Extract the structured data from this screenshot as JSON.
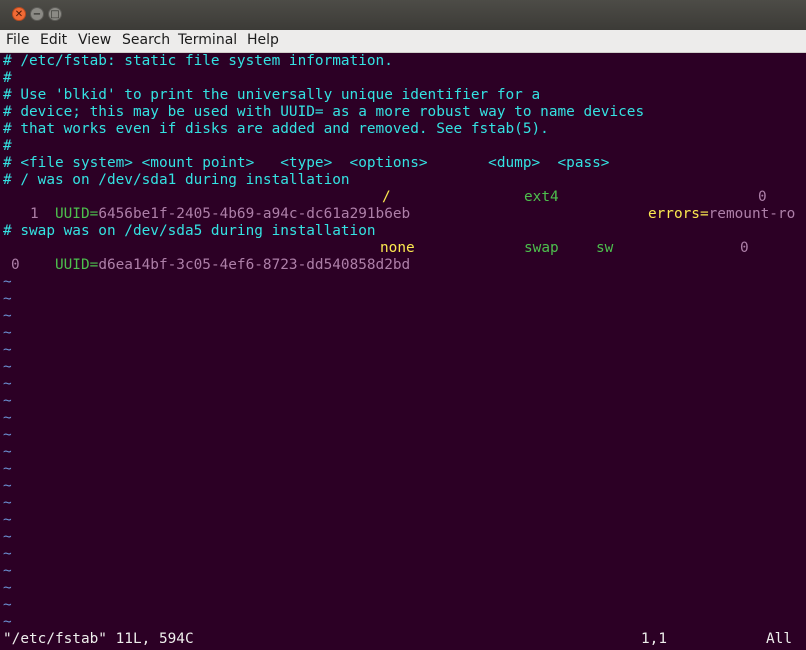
{
  "titlebar": {
    "close_glyph": "✕",
    "minimize_glyph": "−",
    "maximize_glyph": "□"
  },
  "menu": {
    "file": "File",
    "edit": "Edit",
    "view": "View",
    "search": "Search",
    "terminal": "Terminal",
    "help": "Help"
  },
  "editor": {
    "line1": "# /etc/fstab: static file system information.",
    "line2": "#",
    "line3": "# Use 'blkid' to print the universally unique identifier for a",
    "line4": "# device; this may be used with UUID= as a more robust way to name devices",
    "line5": "# that works even if disks are added and removed. See fstab(5).",
    "line6": "#",
    "line7": "# <file system> <mount point>   <type>  <options>       <dump>  <pass>",
    "line8": "# / was on /dev/sda1 during installation",
    "row1": {
      "key": "UUID=",
      "uuid": "6456be1f-2405-4b69-a94c-dc61a291b6eb",
      "mount": "/",
      "type": "ext4",
      "opt_key": "errors=",
      "opt_val": "remount-ro",
      "dump": "0",
      "pass": "1"
    },
    "line11": "# swap was on /dev/sda5 during installation",
    "row2": {
      "key": "UUID=",
      "uuid": "d6ea14bf-3c05-4ef6-8723-dd540858d2bd",
      "mount": "none",
      "type": "swap",
      "opt": "sw",
      "dump": "0",
      "pass": "0"
    },
    "tilde": "~"
  },
  "status": {
    "file": "\"/etc/fstab\" 11L, 594C",
    "position": "1,1",
    "scroll": "All"
  },
  "colors": {
    "background": "#2c0025",
    "comment": "#34e2e2",
    "uuid_key": "#4dbf4d",
    "uuid_value": "#ad7fa8",
    "keyword": "#fce94f",
    "tilde": "#6a8fd1",
    "text": "#eeeeec"
  }
}
